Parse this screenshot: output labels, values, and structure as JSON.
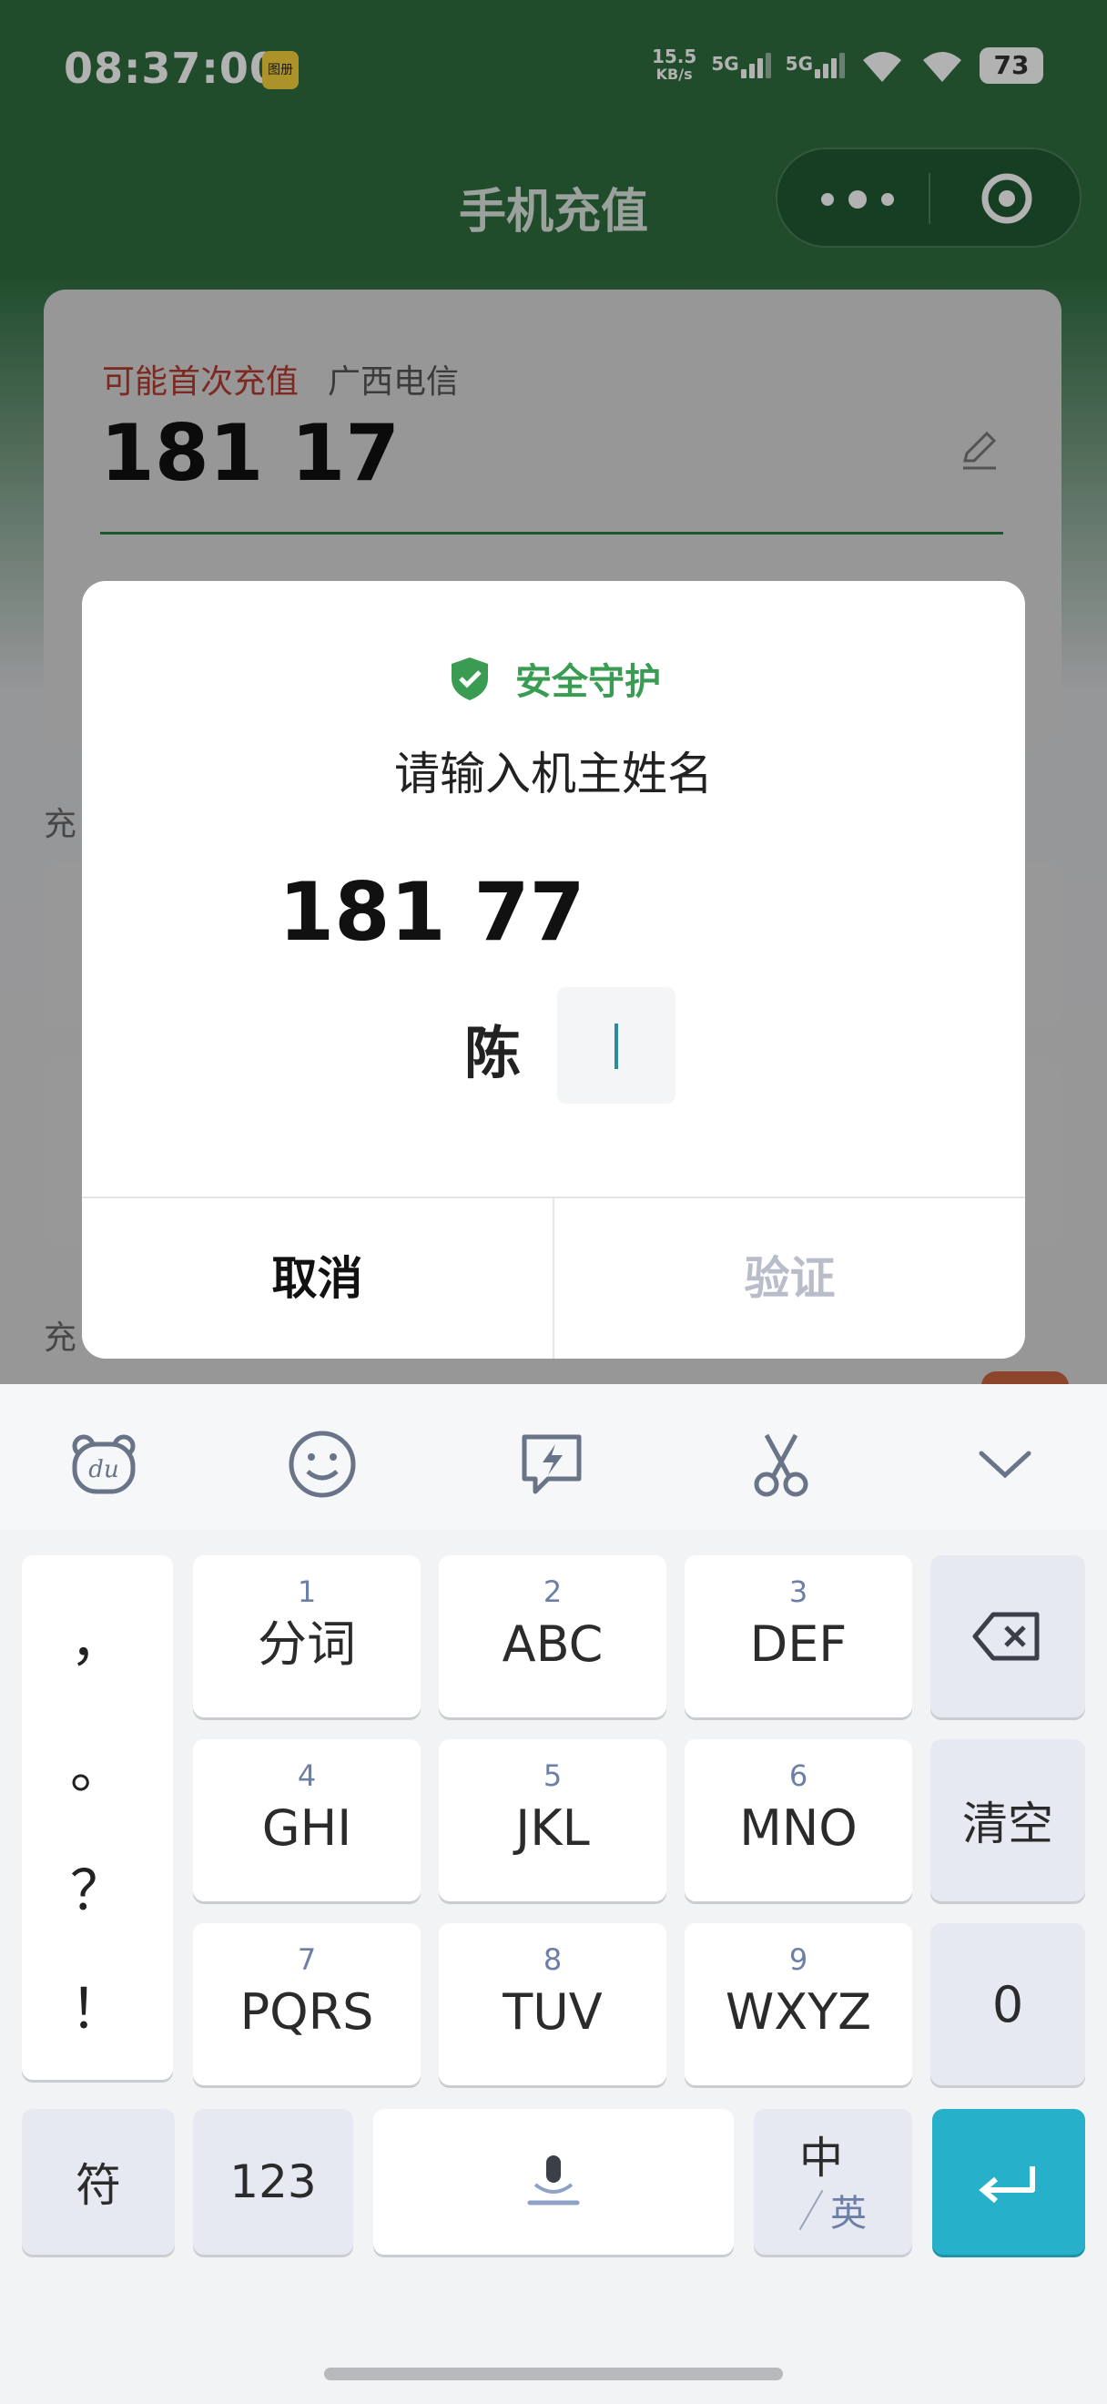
{
  "status_bar": {
    "time": "08:37:00",
    "app_icon": "图册",
    "net_speed_value": "15.5",
    "net_speed_unit": "KB/s",
    "signal_1": "5G",
    "signal_2": "5G",
    "battery": "73"
  },
  "nav": {
    "title": "手机充值",
    "menu_icon": "more-dots-icon",
    "close_icon": "target-circle-icon"
  },
  "card": {
    "first_recharge_tag": "可能首次充值",
    "carrier": "广西电信",
    "phone": "181 17",
    "edit_icon": "pencil-icon"
  },
  "side_labels": [
    "充",
    "充"
  ],
  "dialog": {
    "security_label": "安全守护",
    "prompt": "请输入机主姓名",
    "phone": "181 77",
    "surname": "陈",
    "cancel_label": "取消",
    "verify_label": "验证"
  },
  "keyboard": {
    "toolbar_icons": [
      "du-bear-icon",
      "smiley-icon",
      "lightning-chat-icon",
      "scissors-icon",
      "chevron-down-icon"
    ],
    "punctuation": [
      "，",
      "。",
      "？",
      "！"
    ],
    "keys": [
      {
        "num": "1",
        "label": "分词"
      },
      {
        "num": "2",
        "label": "ABC"
      },
      {
        "num": "3",
        "label": "DEF"
      },
      {
        "num": "4",
        "label": "GHI"
      },
      {
        "num": "5",
        "label": "JKL"
      },
      {
        "num": "6",
        "label": "MNO"
      },
      {
        "num": "7",
        "label": "PQRS"
      },
      {
        "num": "8",
        "label": "TUV"
      },
      {
        "num": "9",
        "label": "WXYZ"
      }
    ],
    "clear_label": "清空",
    "zero_label": "0",
    "symbol_label": "符",
    "num_label": "123",
    "zh_label": "中",
    "en_label": "英"
  },
  "colors": {
    "header_green": "#2e6e3f",
    "safe_green": "#3a9c52",
    "enter_key": "#27b0c9",
    "first_recharge_red": "#b33a2e"
  }
}
